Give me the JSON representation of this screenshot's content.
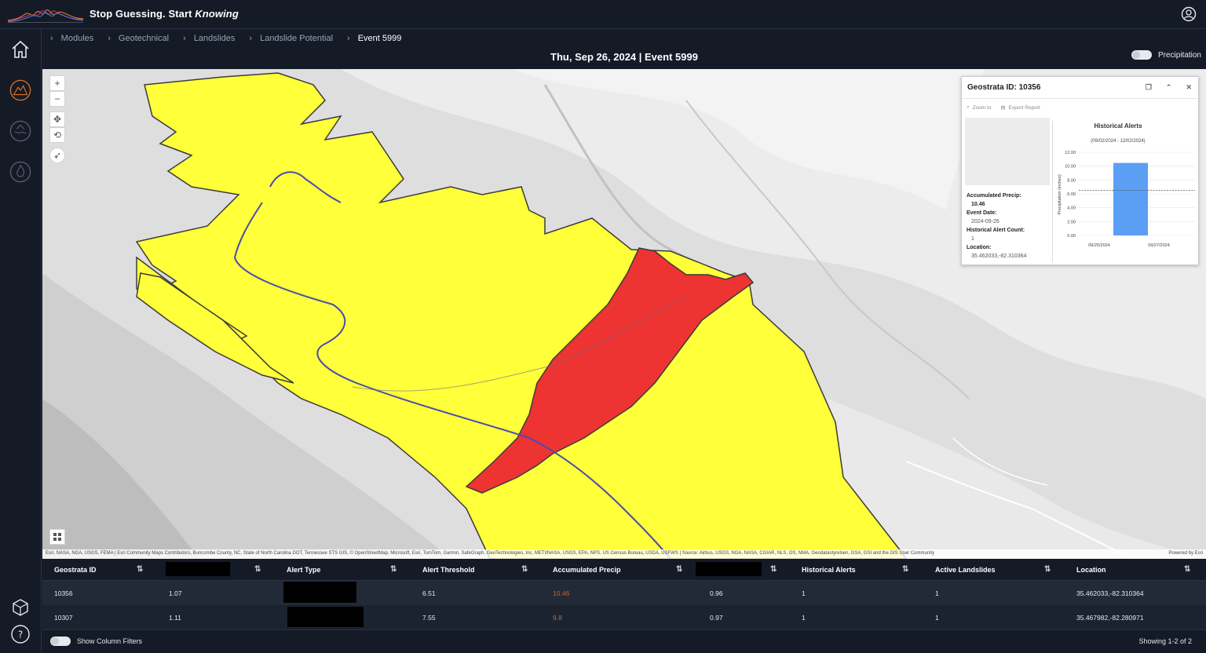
{
  "app": {
    "brand_plain": "Stop Guessing. Start ",
    "brand_italic": "Knowing"
  },
  "breadcrumb": [
    "Modules",
    "Geotechnical",
    "Landslides",
    "Landslide Potential",
    "Event 5999"
  ],
  "page_title": "Thu, Sep 26, 2024 | Event 5999",
  "precip_toggle_label": "Precipitation",
  "map": {
    "attribution": "Esri, NASA, NGA, USGS, FEMA | Esri Community Maps Contributors, Buncombe County, NC, State of North Carolina DOT, Tennessee STS GIS, © OpenStreetMap, Microsoft, Esri, TomTom, Garmin, SafeGraph, GeoTechnologies, Inc, METI/NASA, USGS, EPA, NPS, US Census Bureau, USDA, USFWS | Source: Airbus, USGS, NGA, NASA, CGIAR, NLS, OS, NMA, Geodatastyrelsen, GSA, GSI and the GIS User Community",
    "powered_by": "Powered by Esri",
    "colors": {
      "yellow": "#ffff3a",
      "red": "#ee3333",
      "road": "#4b4bb0"
    }
  },
  "popup": {
    "title": "Geostrata ID: 10356",
    "zoom_label": "Zoom to",
    "export_label": "Export Report",
    "accum_label": "Accumulated Precip:",
    "accum_value": "10.46",
    "event_date_label": "Event Date:",
    "event_date_value": "2024-09-26",
    "hist_count_label": "Historical Alert Count:",
    "hist_count_value": "1",
    "location_label": "Location:",
    "location_value": "35.462033,-82.310364"
  },
  "chart_data": {
    "type": "bar",
    "title": "Historical Alerts",
    "subtitle": "(09/02/2024 - 12/02/2024)",
    "ylabel": "Precipitation (inches)",
    "xlabel": "",
    "x_ticks": [
      "09/25/2024",
      "09/27/2024"
    ],
    "y_ticks": [
      "0.00",
      "2.00",
      "4.00",
      "6.00",
      "8.00",
      "10.00",
      "12.00"
    ],
    "ylim": [
      0,
      12
    ],
    "bars": [
      {
        "x": "09/26/2024",
        "value": 10.46
      }
    ],
    "threshold": 6.51,
    "bar_color": "#5b9ff5"
  },
  "table": {
    "headers": [
      "Geostrata ID",
      "",
      "Alert Type",
      "Alert Threshold",
      "Accumulated Precip",
      "",
      "Historical Alerts",
      "Active Landslides",
      "Location"
    ],
    "rows": [
      [
        "10356",
        "1.07",
        "",
        "6.51",
        "10.46",
        "0.96",
        "1",
        "1",
        "35.462033,-82.310364"
      ],
      [
        "10307",
        "1.11",
        "",
        "7.55",
        "9.8",
        "0.97",
        "1",
        "1",
        "35.467982,-82.280971"
      ]
    ]
  },
  "footer": {
    "filters_label": "Show Column Filters",
    "showing": "Showing 1-2 of 2"
  }
}
